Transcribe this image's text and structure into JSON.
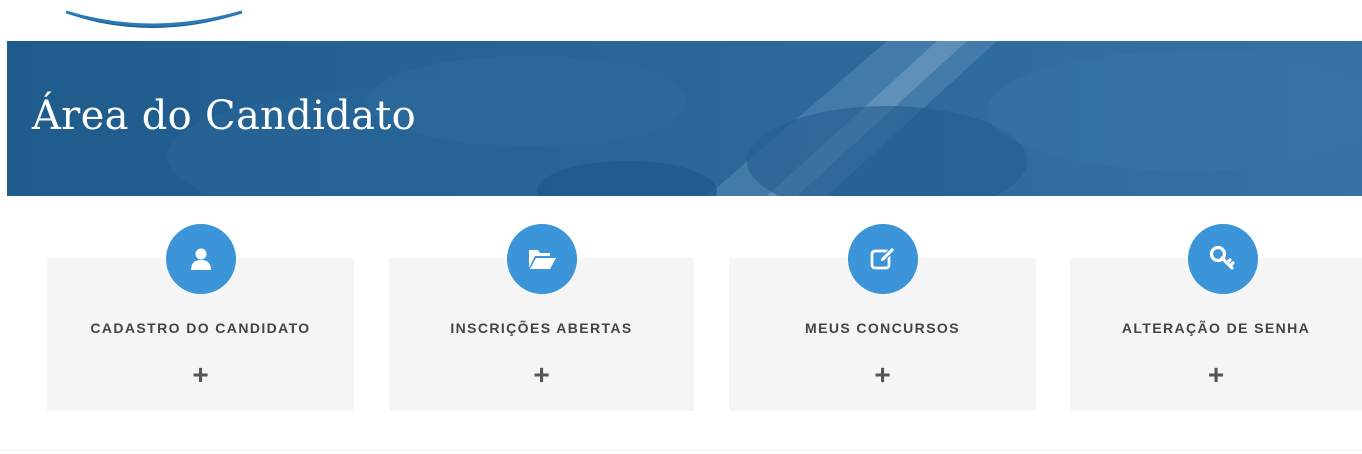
{
  "banner": {
    "title": "Área do Candidato"
  },
  "colors": {
    "accent": "#3b95d8",
    "banner_dark": "#1f5d8c",
    "card_bg": "#f5f5f5"
  },
  "cards": [
    {
      "label": "CADASTRO DO CANDIDATO",
      "icon": "user-icon",
      "expand": "+"
    },
    {
      "label": "INSCRIÇÕES ABERTAS",
      "icon": "folder-open-icon",
      "expand": "+"
    },
    {
      "label": "MEUS CONCURSOS",
      "icon": "edit-icon",
      "expand": "+"
    },
    {
      "label": "ALTERAÇÃO DE SENHA",
      "icon": "key-icon",
      "expand": "+"
    }
  ]
}
